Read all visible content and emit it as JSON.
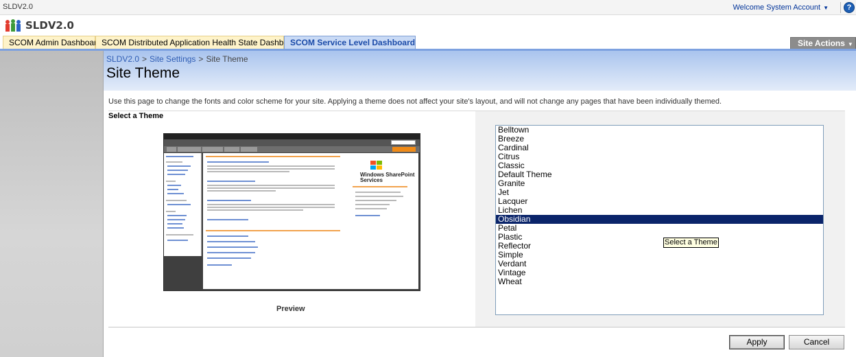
{
  "global": {
    "site_name": "SLDV2.0",
    "welcome": "Welcome System Account",
    "help_icon": "?"
  },
  "header": {
    "title": "SLDV2.0"
  },
  "tabs": [
    {
      "label": "SCOM Admin Dashboard"
    },
    {
      "label": "SCOM Distributed Application Health State Dashboard"
    },
    {
      "label": "SCOM Service Level Dashboard"
    }
  ],
  "site_actions": {
    "label": "Site Actions"
  },
  "breadcrumb": {
    "items": [
      "SLDV2.0",
      "Site Settings",
      "Site Theme"
    ],
    "separator": ">"
  },
  "page": {
    "title": "Site Theme",
    "description": "Use this page to change the fonts and color scheme for your site. Applying a theme does not affect your site's layout, and will not change any pages that have been individually themed."
  },
  "section": {
    "title": "Select a Theme",
    "preview_label": "Preview",
    "preview_brand": "Windows SharePoint Services"
  },
  "themes": {
    "items": [
      "Belltown",
      "Breeze",
      "Cardinal",
      "Citrus",
      "Classic",
      "Default Theme",
      "Granite",
      "Jet",
      "Lacquer",
      "Lichen",
      "Obsidian",
      "Petal",
      "Plastic",
      "Reflector",
      "Simple",
      "Verdant",
      "Vintage",
      "Wheat"
    ],
    "selected": "Obsidian",
    "tooltip": "Select a Theme"
  },
  "buttons": {
    "apply": "Apply",
    "cancel": "Cancel"
  },
  "colors": {
    "accent": "#7da1e0",
    "selection": "#0a246a",
    "tab_background": "#fef3c9"
  }
}
